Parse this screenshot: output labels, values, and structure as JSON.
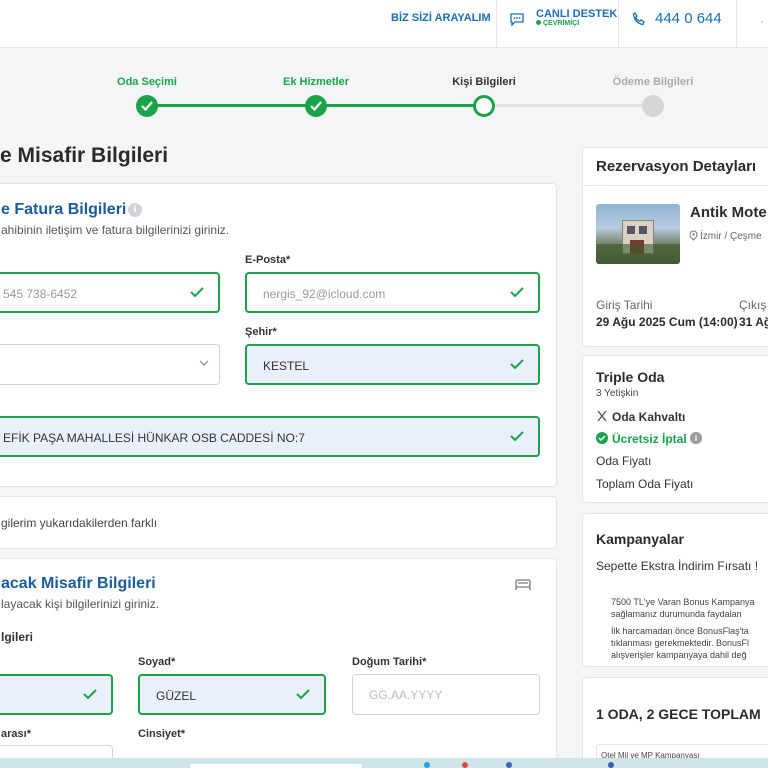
{
  "topbar": {
    "callback": "BİZ SİZİ ARAYALIM",
    "live_support": "CANLI DESTEK",
    "online": "ÇEVRİMİÇİ",
    "phone": "444 0 644"
  },
  "steps": [
    {
      "label": "Oda Seçimi",
      "status": "done"
    },
    {
      "label": "Ek Hizmetler",
      "status": "done"
    },
    {
      "label": "Kişi Bilgileri",
      "status": "current"
    },
    {
      "label": "Ödeme Bilgileri",
      "status": "todo"
    }
  ],
  "page_title": "e Misafir Bilgileri",
  "contact": {
    "title": "e Fatura Bilgileri",
    "subtitle": "ahibinin iletişim ve fatura bilgilerinizi giriniz.",
    "phone_value": "545 738-6452",
    "email_label": "E-Posta*",
    "email_value": "nergis_92@icloud.com",
    "city_label": "Şehir*",
    "city_value": "KESTEL",
    "address_value": "EFİK PAŞA MAHALLESİ HÜNKAR OSB CADDESİ NO:7"
  },
  "billing_diff": "gilerim yukarıdakilerden farklı",
  "guests": {
    "title": "acak Misafir Bilgileri",
    "subtitle": "layacak kişi bilgilerinizi giriniz.",
    "person_heading": "lgileri",
    "surname_label": "Soyad*",
    "surname_value": "GÜZEL",
    "dob_label": "Doğum Tarihi*",
    "dob_placeholder": "GG.AA.YYYY",
    "id_label": "arası*",
    "gender_label": "Cinsiyet*"
  },
  "reservation": {
    "title": "Rezervasyon Detayları",
    "hotel_name": "Antik Mote",
    "location": "İzmir / Çeşme",
    "checkin_label": "Giriş Tarihi",
    "checkin_value": "29 Ağu 2025 Cum (14:00)",
    "checkout_label": "Çıkış",
    "checkout_value": "31 Ağ"
  },
  "room": {
    "name": "Triple Oda",
    "guests": "3 Yetişkin",
    "board": "Oda Kahvaltı",
    "cancel": "Ücretsiz İptal",
    "room_price": "Oda Fiyatı",
    "total_price": "Toplam Oda Fiyatı"
  },
  "campaigns": {
    "title": "Kampanyalar",
    "item": "Sepette Ekstra İndirim Fırsatı !",
    "desc1a": "7500 TL'ye Varan Bonus Kampanya",
    "desc1b": "sağlamanız durumunda faydalan",
    "desc2a": "İlk harcamadan önce BonusFlaş'ta",
    "desc2b": "tıklanması gerekmektedir. BonusFl",
    "desc2c": "alışverişler kampanyaya dahil değ"
  },
  "summary": {
    "title": "1 ODA, 2 GECE TOPLAM",
    "note": "Otel Mil ve MP Kampanyası"
  },
  "colors": {
    "accent_green": "#1aa34a",
    "brand_blue": "#1a5c9e",
    "link_blue": "#1a6fb5"
  }
}
